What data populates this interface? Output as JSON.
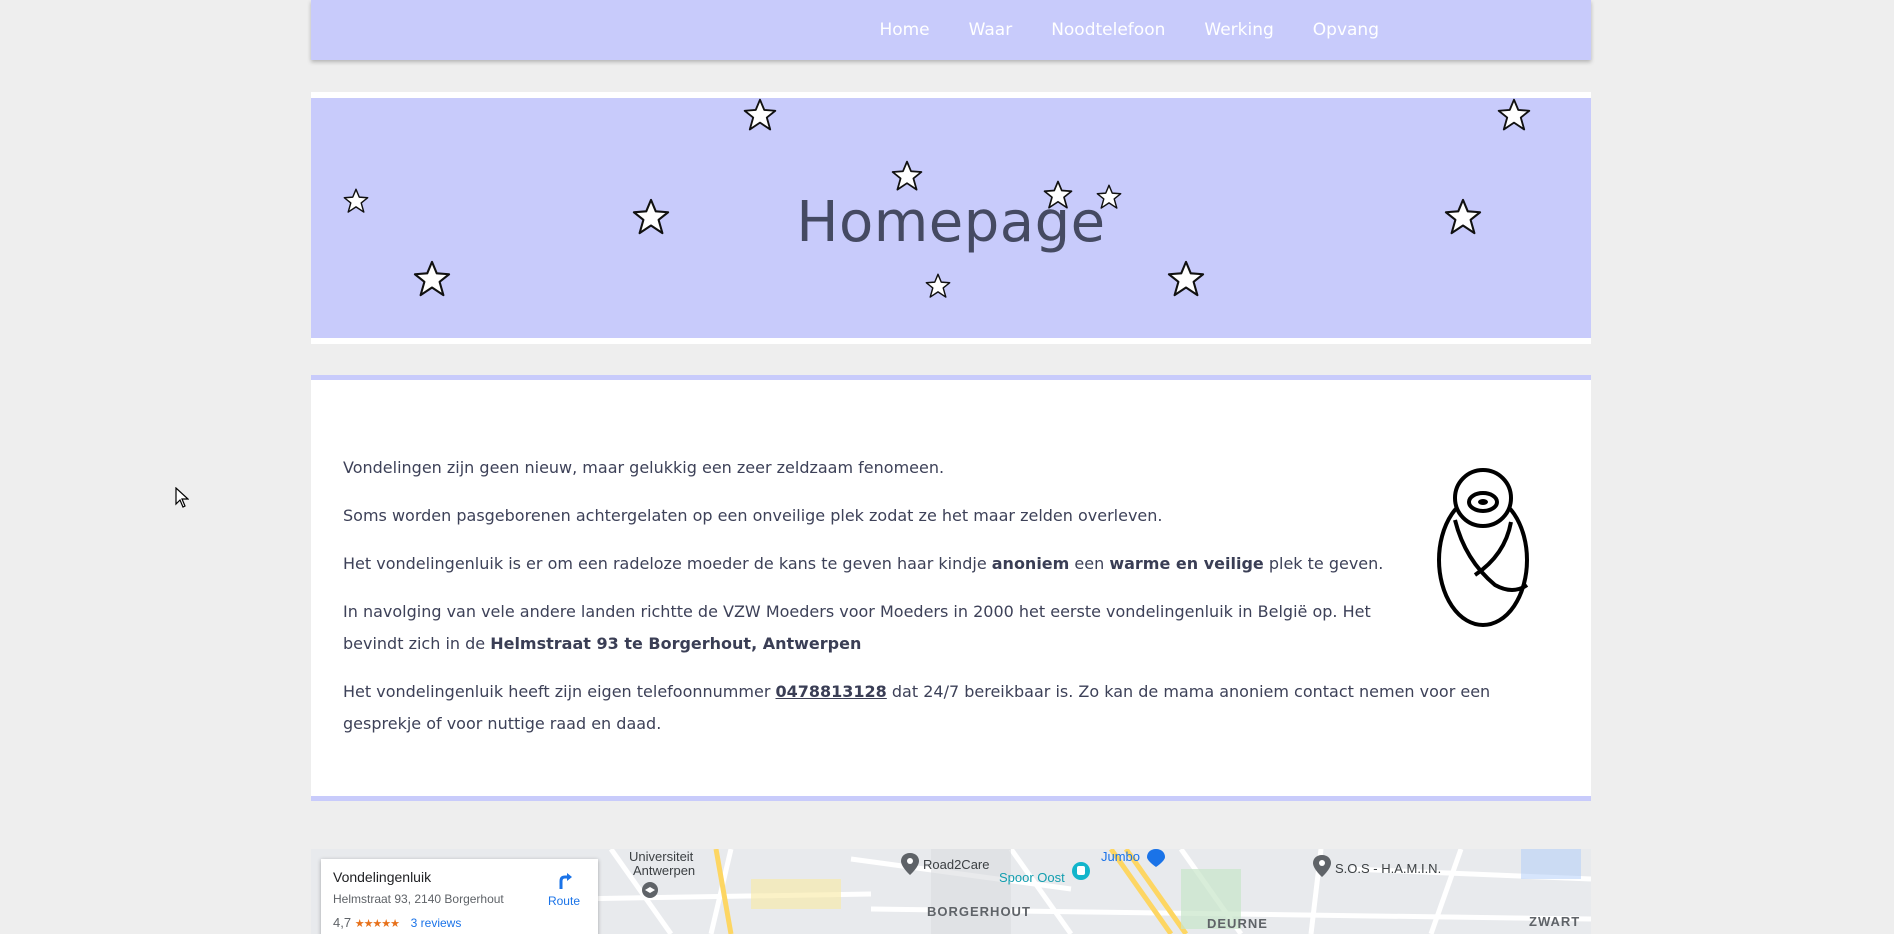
{
  "nav": {
    "items": [
      {
        "label": "Home"
      },
      {
        "label": "Waar"
      },
      {
        "label": "Noodtelefoon"
      },
      {
        "label": "Werking"
      },
      {
        "label": "Opvang"
      }
    ]
  },
  "hero": {
    "title": "Homepage"
  },
  "content": {
    "p1": "Vondelingen zijn geen nieuw, maar gelukkig een zeer zeldzaam fenomeen.",
    "p2": "Soms worden pasgeborenen achtergelaten op een onveilige plek zodat ze het maar zelden overleven.",
    "p3_a": "Het vondelingenluik is er om een radeloze moeder de kans te geven haar kindje ",
    "p3_b": "anoniem",
    "p3_c": " een ",
    "p3_d": "warme en veilige",
    "p3_e": " plek te geven.",
    "p4_a": "In navolging van vele andere landen richtte de VZW Moeders voor Moeders in 2000 het eerste vondelingenluik in België op. Het bevindt zich in de ",
    "p4_b": "Helmstraat 93 te Borgerhout, Antwerpen",
    "p5_a": "Het vondelingenluik heeft zijn eigen telefoonnummer ",
    "p5_phone": "0478813128",
    "p5_b": " dat 24/7 bereikbaar is. Zo kan de mama anoniem contact nemen voor een gesprekje of voor nuttige raad en daad."
  },
  "map": {
    "place_name": "Vondelingenluik",
    "address": "Helmstraat 93, 2140 Borgerhout",
    "rating": "4,7",
    "stars": "★★★★★",
    "reviews": "3 reviews",
    "route_label": "Route",
    "labels": {
      "universiteit": "Universiteit",
      "antwerpen": "Antwerpen",
      "road2care": "Road2Care",
      "spoor_oost": "Spoor Oost",
      "jumbo": "Jumbo",
      "sos": "S.O.S - H.A.M.I.N.",
      "borgerhout": "BORGERHOUT",
      "deurne": "DEURNE",
      "zwart": "ZWART"
    }
  },
  "colors": {
    "accent": "#c8cbfb",
    "text": "#3d4158",
    "background": "#eeeeee"
  }
}
